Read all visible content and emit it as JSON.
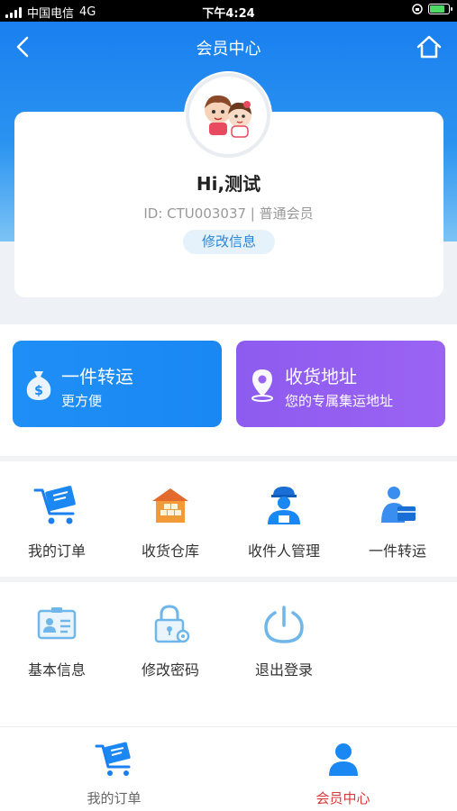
{
  "status_bar": {
    "carrier": "中国电信",
    "network": "4G",
    "time": "下午4:24"
  },
  "header": {
    "title": "会员中心"
  },
  "profile": {
    "greeting": "Hi,测试",
    "id_line": "ID: CTU003037 | 普通会员",
    "edit_label": "修改信息"
  },
  "actions": [
    {
      "title": "一件转运",
      "subtitle": "更方便",
      "icon": "money-bag-icon"
    },
    {
      "title": "收货地址",
      "subtitle": "您的专属集运地址",
      "icon": "location-pin-icon"
    }
  ],
  "menu_row1": [
    {
      "label": "我的订单",
      "icon": "cart-icon"
    },
    {
      "label": "收货仓库",
      "icon": "warehouse-icon"
    },
    {
      "label": "收件人管理",
      "icon": "courier-icon"
    },
    {
      "label": "一件转运",
      "icon": "package-person-icon"
    }
  ],
  "menu_row2": [
    {
      "label": "基本信息",
      "icon": "id-card-icon"
    },
    {
      "label": "修改密码",
      "icon": "lock-icon"
    },
    {
      "label": "退出登录",
      "icon": "power-icon"
    }
  ],
  "tabbar": [
    {
      "label": "我的订单",
      "icon": "cart-icon",
      "active": false
    },
    {
      "label": "会员中心",
      "icon": "user-icon",
      "active": true
    }
  ],
  "colors": {
    "primary": "#1a87f3",
    "purple": "#9a63f2",
    "active_tab": "#d83a3a"
  }
}
